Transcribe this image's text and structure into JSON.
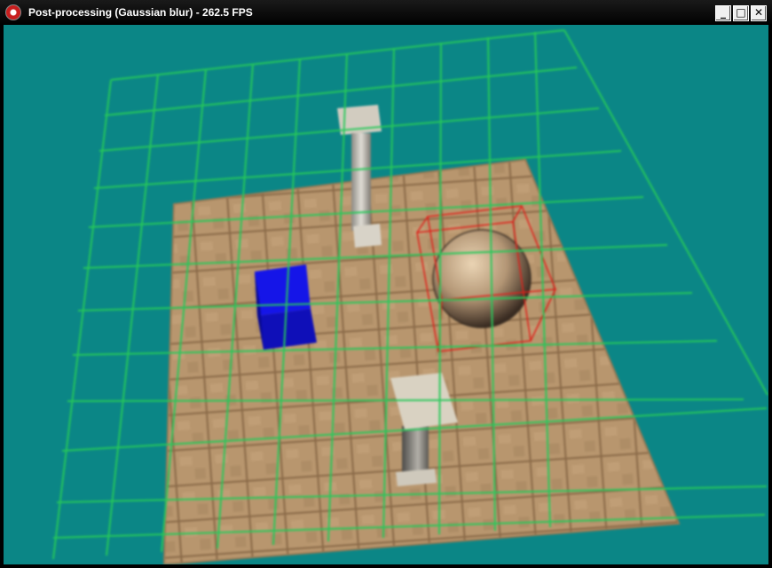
{
  "window": {
    "title": "Post-processing (Gaussian blur) - 262.5 FPS",
    "controls": {
      "minimize": "_",
      "maximize": "□",
      "close": "✕"
    }
  },
  "scene": {
    "background_color": "#0b8686",
    "grid_color": "#27c95a",
    "floor_color": "#b5946c",
    "cube_color": "#1210d8",
    "bounding_box_color": "#e0201a"
  }
}
